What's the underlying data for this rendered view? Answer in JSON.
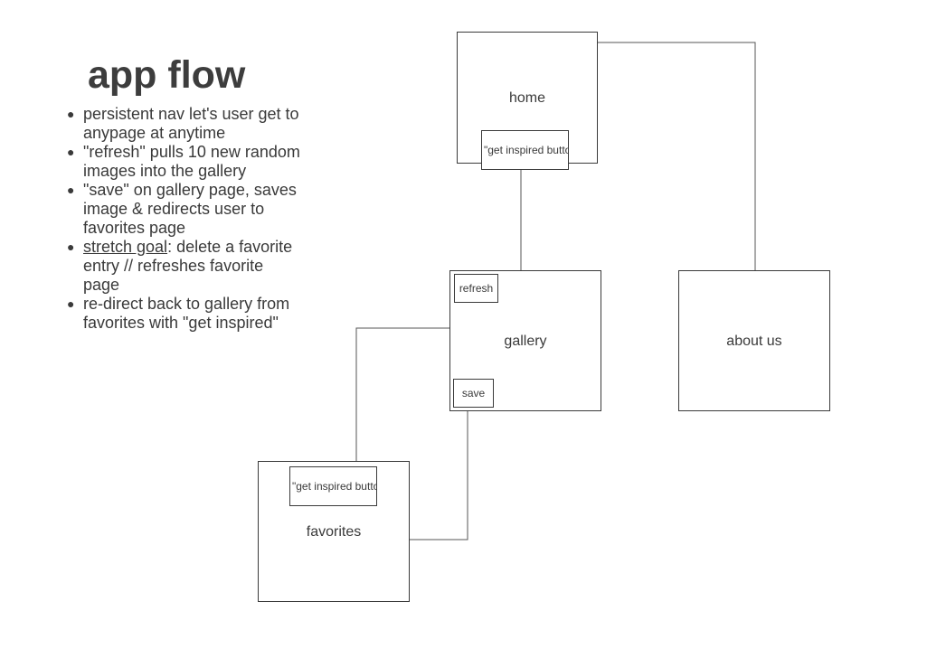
{
  "title": "app flow",
  "notes": [
    {
      "text": "persistent nav let's user get to anypage at anytime"
    },
    {
      "text": "\"refresh\" pulls 10 new random images into the gallery"
    },
    {
      "text": "\"save\" on gallery page, saves image & redirects user to favorites page"
    },
    {
      "prefix": "stretch goal",
      "text": ": delete a favorite entry // refreshes favorite page"
    },
    {
      "text": "re-direct back to gallery from favorites with \"get inspired\""
    }
  ],
  "pages": {
    "home": {
      "label": "home",
      "button": "\"get inspired button\""
    },
    "gallery": {
      "label": "gallery",
      "refresh": "refresh",
      "save": "save"
    },
    "about": {
      "label": "about us"
    },
    "favorites": {
      "label": "favorites",
      "button": "\"get inspired button\""
    }
  }
}
